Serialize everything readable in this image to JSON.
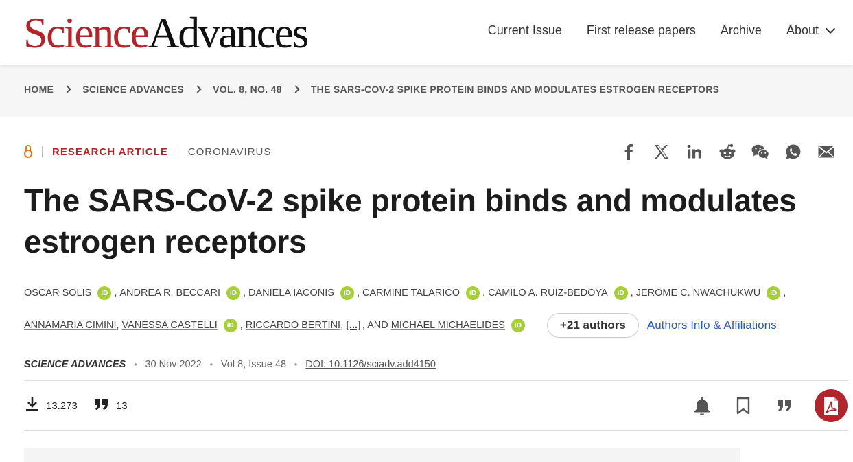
{
  "header": {
    "logo_part1": "Science",
    "logo_part2": "Advances",
    "nav": [
      "Current Issue",
      "First release papers",
      "Archive",
      "About"
    ]
  },
  "breadcrumb": [
    "HOME",
    "SCIENCE ADVANCES",
    "VOL. 8, NO. 48",
    "THE SARS-COV-2 SPIKE PROTEIN BINDS AND MODULATES ESTROGEN RECEPTORS"
  ],
  "article": {
    "type": "RESEARCH ARTICLE",
    "topic": "CORONAVIRUS",
    "title": "The SARS-CoV-2 spike protein binds and modulates estrogen receptors",
    "authors_line1": [
      "OSCAR SOLIS",
      "ANDREA R. BECCARI",
      "DANIELA IACONIS",
      "CARMINE TALARICO",
      "CAMILO A. RUIZ-BEDOYA",
      "JEROME C. NWACHUKWU"
    ],
    "authors_line2": [
      "ANNAMARIA CIMINI",
      "VANESSA CASTELLI",
      "RICCARDO BERTINI"
    ],
    "ellipsis": "[...]",
    "and_text": ", AND",
    "last_author": "MICHAEL MICHAELIDES",
    "orcid_label": "iD",
    "more_authors": "+21 authors",
    "affiliations_link": "Authors Info & Affiliations",
    "journal": "SCIENCE ADVANCES",
    "date": "30 Nov 2022",
    "volume": "Vol 8, Issue 48",
    "doi": "DOI: 10.1126/sciadv.add4150"
  },
  "metrics": {
    "downloads": "13.273",
    "citations": "13"
  },
  "share_icons": [
    "facebook-icon",
    "x-twitter-icon",
    "linkedin-icon",
    "reddit-icon",
    "wechat-icon",
    "whatsapp-icon",
    "email-icon"
  ],
  "colors": {
    "brand_red": "#b0262c",
    "open_access": "#e07b1a",
    "orcid_green": "#a6ce39",
    "link_blue": "#2a5fb0"
  }
}
